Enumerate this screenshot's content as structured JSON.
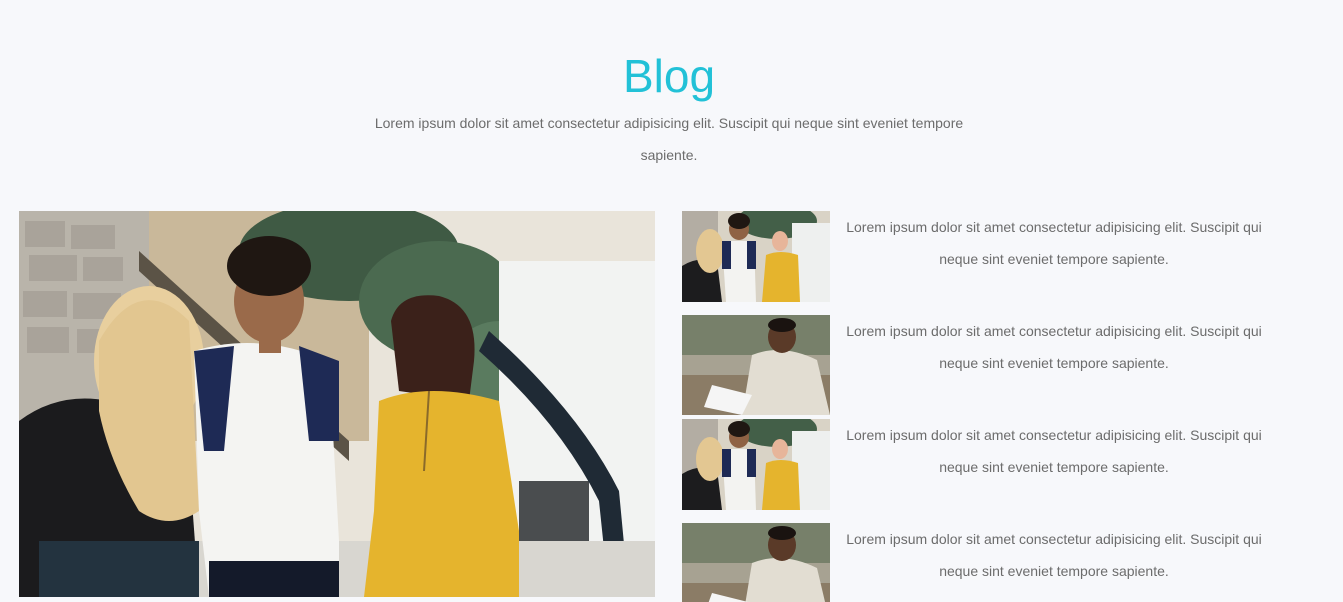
{
  "section": {
    "title": "Blog",
    "subtitle": "Lorem ipsum dolor sit amet consectetur adipisicing elit. Suscipit qui neque sint eveniet tempore sapiente."
  },
  "featured": {
    "image": "group-of-friends-photo"
  },
  "posts": [
    {
      "image": "group-of-friends-photo",
      "text": "Lorem ipsum dolor sit amet consectetur adipisicing elit. Suscipit qui neque sint eveniet tempore sapiente."
    },
    {
      "image": "man-reading-photo",
      "text": "Lorem ipsum dolor sit amet consectetur adipisicing elit. Suscipit qui neque sint eveniet tempore sapiente."
    },
    {
      "image": "group-of-friends-photo",
      "text": "Lorem ipsum dolor sit amet consectetur adipisicing elit. Suscipit qui neque sint eveniet tempore sapiente."
    },
    {
      "image": "man-reading-photo",
      "text": "Lorem ipsum dolor sit amet consectetur adipisicing elit. Suscipit qui neque sint eveniet tempore sapiente."
    }
  ],
  "colors": {
    "accent": "#22c1d7",
    "background": "#f7f8fb",
    "body_text": "#6c6c6c"
  }
}
